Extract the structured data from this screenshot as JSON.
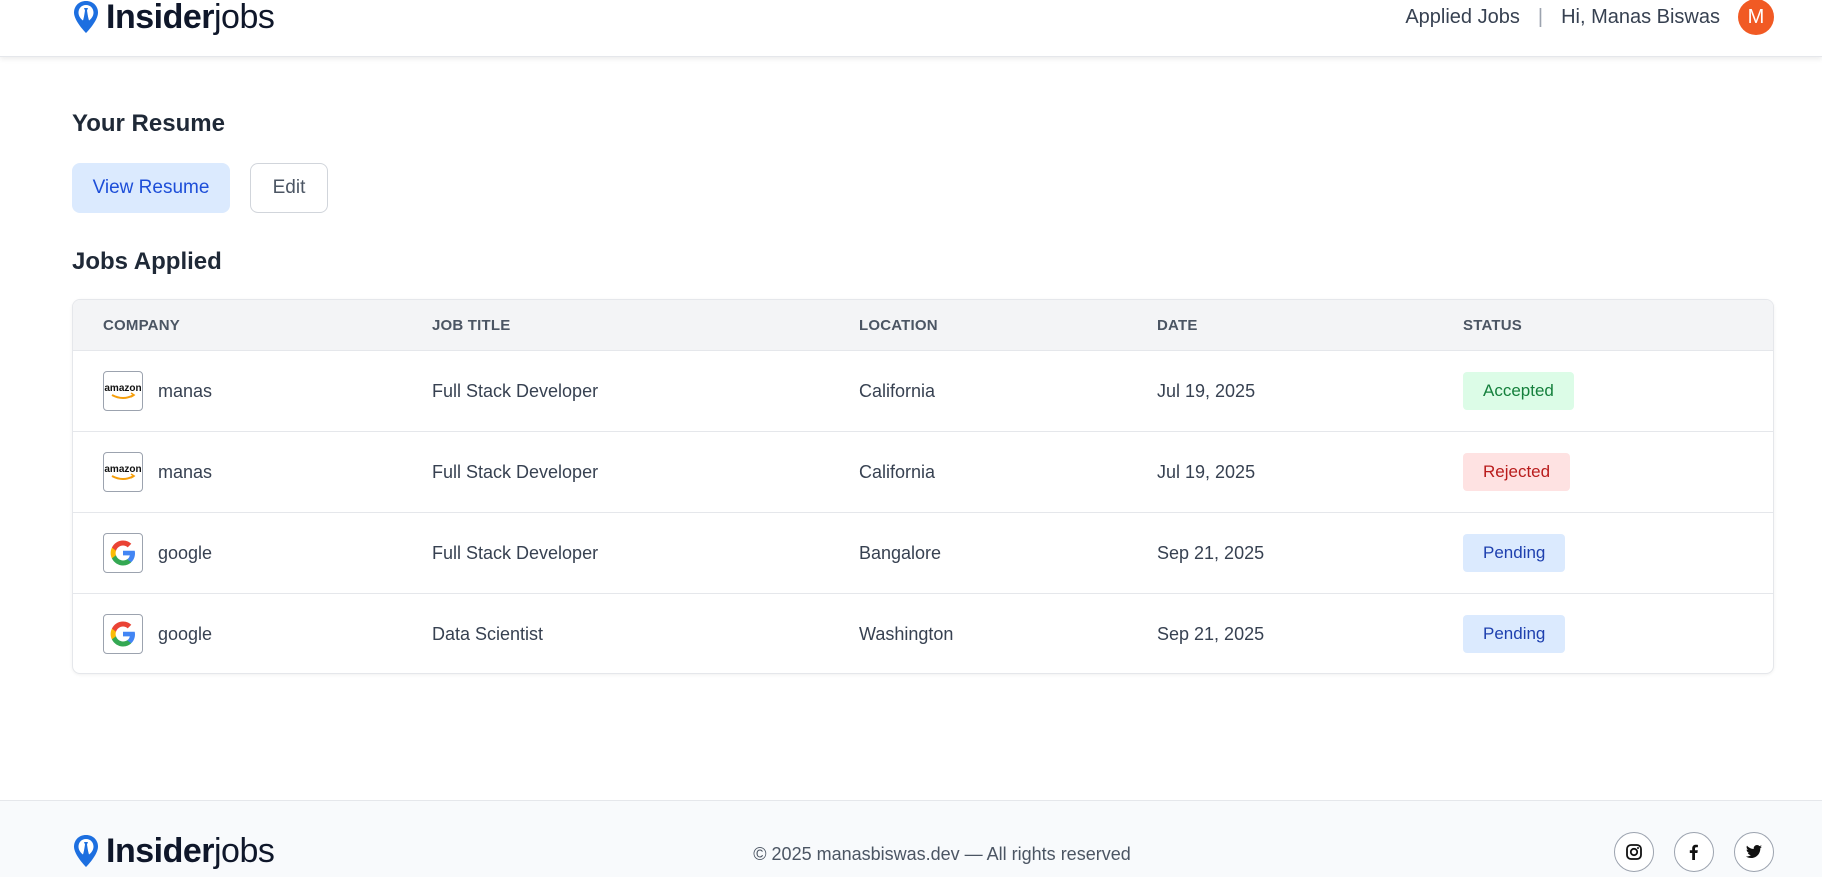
{
  "header": {
    "brand_bold": "Insider",
    "brand_light": "jobs",
    "nav_applied": "Applied Jobs",
    "separator": "|",
    "greeting": "Hi, Manas Biswas",
    "avatar_letter": "M"
  },
  "resume": {
    "title": "Your Resume",
    "view_label": "View Resume",
    "edit_label": "Edit"
  },
  "jobs": {
    "title": "Jobs Applied",
    "columns": [
      "Company",
      "Job Title",
      "Location",
      "Date",
      "Status"
    ],
    "rows": [
      {
        "logo_icon": "amazon-logo-icon",
        "company": "manas",
        "title": "Full Stack Developer",
        "location": "California",
        "date": "Jul 19, 2025",
        "status": "Accepted",
        "status_kind": "accepted"
      },
      {
        "logo_icon": "amazon-logo-icon",
        "company": "manas",
        "title": "Full Stack Developer",
        "location": "California",
        "date": "Jul 19, 2025",
        "status": "Rejected",
        "status_kind": "rejected"
      },
      {
        "logo_icon": "google-logo-icon",
        "company": "google",
        "title": "Full Stack Developer",
        "location": "Bangalore",
        "date": "Sep 21, 2025",
        "status": "Pending",
        "status_kind": "pending"
      },
      {
        "logo_icon": "google-logo-icon",
        "company": "google",
        "title": "Data Scientist",
        "location": "Washington",
        "date": "Sep 21, 2025",
        "status": "Pending",
        "status_kind": "pending"
      }
    ]
  },
  "footer": {
    "brand_bold": "Insider",
    "brand_light": "jobs",
    "copyright": "© 2025 manasbiswas.dev — All rights reserved",
    "socials": [
      "instagram-icon",
      "facebook-icon",
      "twitter-icon"
    ]
  },
  "colors": {
    "brand_blue": "#1d6fe0",
    "avatar": "#f15a24",
    "accepted_bg": "#dcfce7",
    "rejected_bg": "#fee2e2",
    "pending_bg": "#dbeafe"
  }
}
